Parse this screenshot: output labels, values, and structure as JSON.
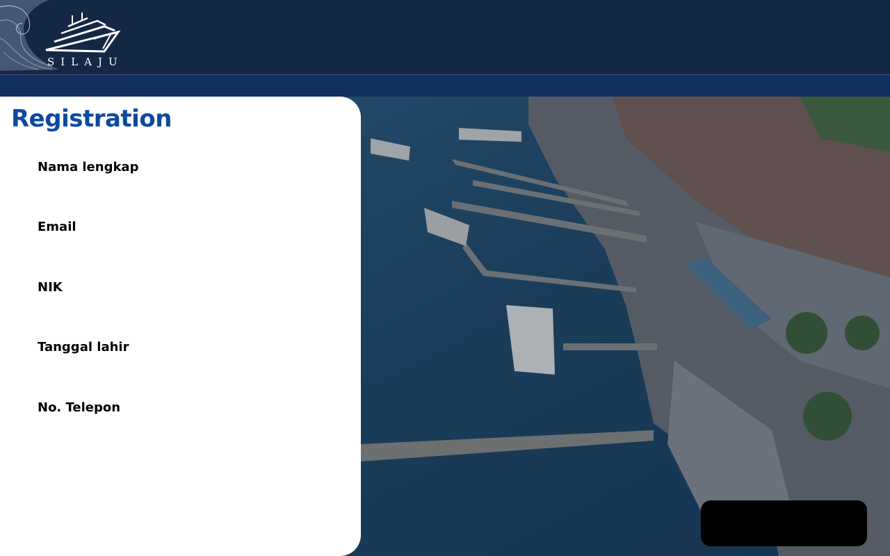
{
  "header": {
    "logo_text": "SILAJU",
    "colors": {
      "navbar": "#142745",
      "subbar": "#12305e"
    }
  },
  "registration": {
    "title": "Registration",
    "fields": [
      {
        "label": "Nama lengkap",
        "value": ""
      },
      {
        "label": "Email",
        "value": ""
      },
      {
        "label": "NIK",
        "value": ""
      },
      {
        "label": "Tanggal lahir",
        "value": ""
      },
      {
        "label": "No. Telepon",
        "value": ""
      }
    ],
    "submit_label": ""
  },
  "colors": {
    "title": "#0d4aa0",
    "button": "#000000"
  },
  "icons": {
    "logo": "wave-ship-logo-icon",
    "background": "ferry-harbor-aerial-photo"
  }
}
